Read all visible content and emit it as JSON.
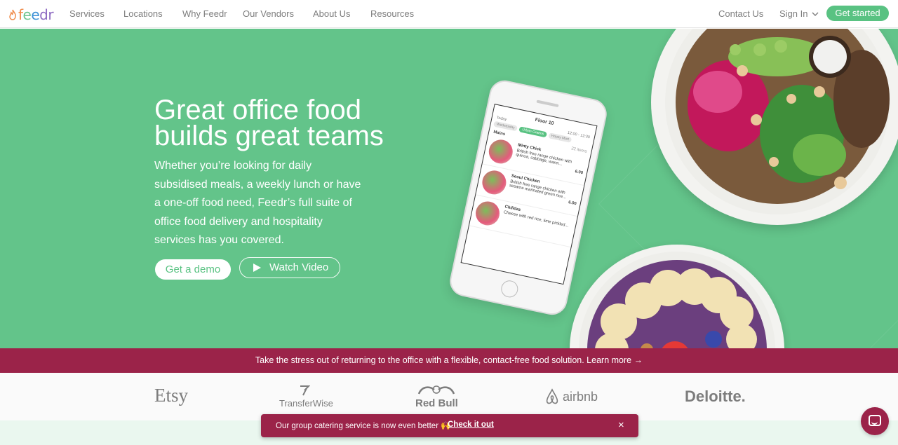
{
  "brand": {
    "logo_text": "feedr",
    "accent": "#59c282",
    "promo_color": "#9b2349"
  },
  "nav": {
    "links": [
      "Services",
      "Locations",
      "Why Feedr",
      "Our Vendors",
      "About Us",
      "Resources"
    ],
    "contact": "Contact Us",
    "signin": "Sign In",
    "cta": "Get started"
  },
  "hero": {
    "title_line1": "Great office food",
    "title_line2": "builds great teams",
    "subtitle": "Whether you’re looking for daily subsidised meals, a weekly lunch or have a one-off food need, Feedr’s full suite of office food delivery and hospitality services has you covered.",
    "demo_button": "Get a demo",
    "video_button": "Watch Video"
  },
  "phone": {
    "header": "Floor 10",
    "date": "Today",
    "time": "12:00 - 12:30",
    "tabs": [
      "Wednesday",
      "Urban Greens",
      "Hopsy Mart"
    ],
    "section": "Mains",
    "count": "22 items",
    "meals": [
      {
        "name": "Minty Chick",
        "desc": "British free range chicken with quinoa, cabbage, warm...",
        "price": "6.00"
      },
      {
        "name": "Seoul Chicken",
        "desc": "British free range chicken with sesame marinated green rice...",
        "price": "6.00"
      },
      {
        "name": "Chilidaz",
        "desc": "Cheese with red rice, lime pickled...",
        "price": ""
      }
    ]
  },
  "promo_bar": {
    "text": "Take the stress out of returning to the office with a flexible, contact-free food solution. Learn more →"
  },
  "client_logos": [
    "Etsy",
    "TransferWise",
    "Red Bull",
    "airbnb",
    "Deloitte."
  ],
  "toast": {
    "message": "Our group catering service is now even better 🙌",
    "cta": "Check it out",
    "close": "×"
  },
  "chat": {
    "icon": "chat-icon"
  }
}
